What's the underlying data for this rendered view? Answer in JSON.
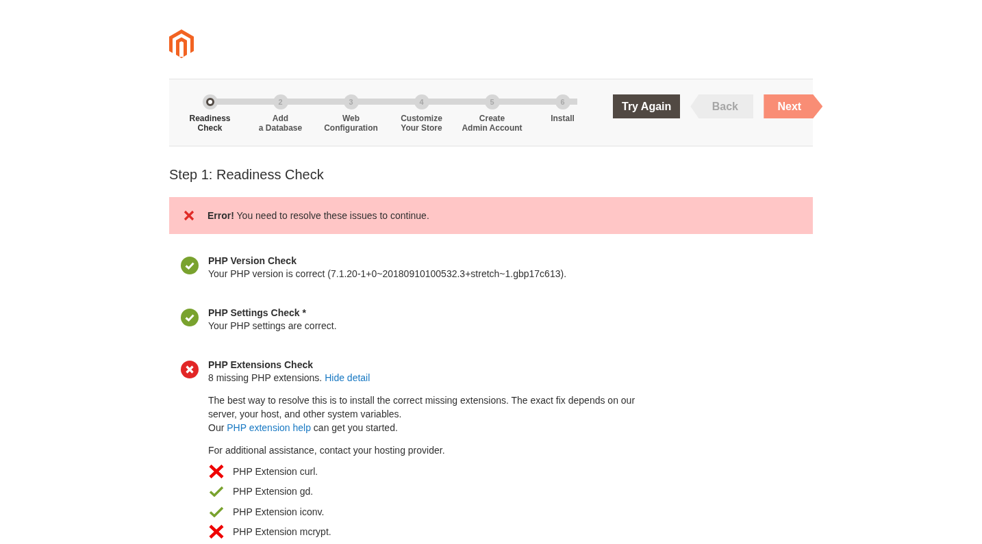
{
  "steps": [
    {
      "label": [
        "Readiness",
        "Check"
      ],
      "selected": true
    },
    {
      "number": "2",
      "label": [
        "Add",
        "a Database"
      ],
      "selected": false
    },
    {
      "number": "3",
      "label": [
        "Web",
        "Configuration"
      ],
      "selected": false
    },
    {
      "number": "4",
      "label": [
        "Customize",
        "Your Store"
      ],
      "selected": false
    },
    {
      "number": "5",
      "label": [
        "Create",
        "Admin Account"
      ],
      "selected": false
    },
    {
      "number": "6",
      "label": [
        "Install"
      ],
      "selected": false
    }
  ],
  "buttons": [
    {
      "kind": "primary",
      "label": "Try Again"
    },
    {
      "kind": "back",
      "label": "Back"
    },
    {
      "kind": "next",
      "label": "Next"
    }
  ],
  "page_title": "Step 1: Readiness Check",
  "error_message": "**Error!** You need to resolve these issues to continue.",
  "checks": [
    {
      "passed": true,
      "title": "PHP Version Check",
      "message": "Your PHP version is correct (7.1.20-1+0~20180910100532.3+stretch~1.gbp17c613)."
    },
    {
      "passed": true,
      "title": "PHP Settings Check *",
      "message": "Your PHP settings are correct."
    },
    {
      "passed": false,
      "title": "PHP Extensions Check",
      "message": "8 missing PHP extensions.",
      "link": "Hide detail",
      "detail": {
        "paragraph": "The best way to resolve this is to install the correct missing extensions. The exact fix depends on our server, your host, and other system variables.",
        "help_before": "Our",
        "help_link": "PHP extension help",
        "help_after": "can get you started.",
        "assistance": "For additional assistance, contact your hosting provider.",
        "extensions": [
          {
            "name": "PHP Extension curl.",
            "installed": false
          },
          {
            "name": "PHP Extension gd.",
            "installed": true
          },
          {
            "name": "PHP Extension iconv.",
            "installed": true
          },
          {
            "name": "PHP Extension mcrypt.",
            "installed": false
          }
        ]
      }
    }
  ]
}
